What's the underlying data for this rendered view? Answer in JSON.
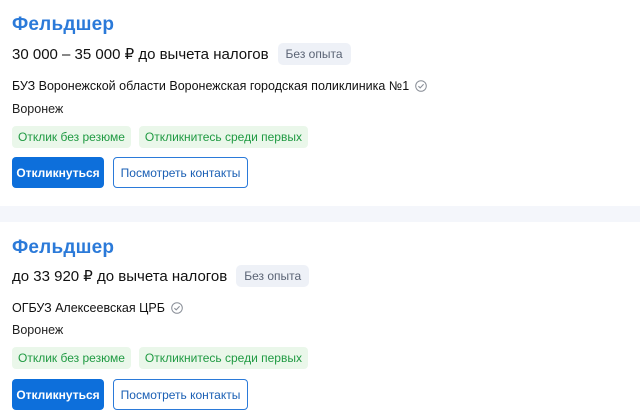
{
  "vacancies": [
    {
      "title": "Фельдшер",
      "salary": "30 000 – 35 000 ₽ до вычета налогов",
      "experience_badge": "Без опыта",
      "company": "БУЗ Воронежской области Воронежская городская поликлиника №1",
      "company_verified_icon": "check-circle-icon",
      "city": "Воронеж",
      "tags": [
        "Отклик без резюме",
        "Откликнитесь среди первых"
      ],
      "respond_label": "Откликнуться",
      "contacts_label": "Посмотреть контакты"
    },
    {
      "title": "Фельдшер",
      "salary": "до 33 920 ₽ до вычета налогов",
      "experience_badge": "Без опыта",
      "company": "ОГБУЗ Алексеевская ЦРБ",
      "company_verified_icon": "check-circle-icon",
      "city": "Воронеж",
      "tags": [
        "Отклик без резюме",
        "Откликнитесь среди первых"
      ],
      "respond_label": "Откликнуться",
      "contacts_label": "Посмотреть контакты"
    }
  ],
  "colors": {
    "title": "#2b7ad9",
    "primary_button": "#0d6fdb",
    "tag_bg": "#eaf7ea",
    "tag_text": "#1f9a42",
    "badge_bg": "#eef1f7"
  }
}
